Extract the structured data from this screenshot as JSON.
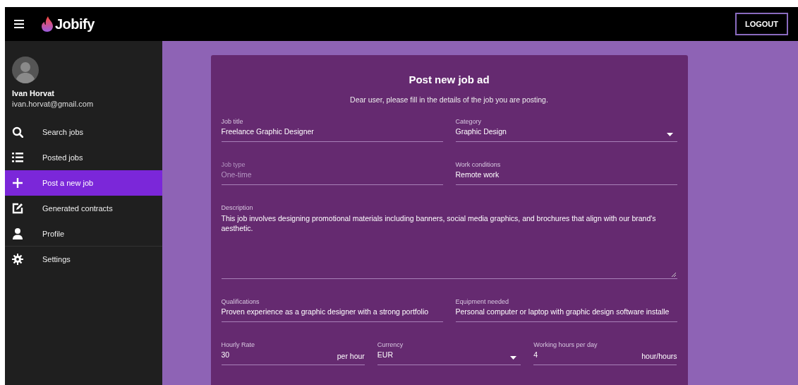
{
  "app_bar": {
    "brand": "Jobify",
    "logout": "LOGOUT"
  },
  "user": {
    "name": "Ivan Horvat",
    "email": "ivan.horvat@gmail.com"
  },
  "sidebar": {
    "items": [
      {
        "label": "Search jobs",
        "selected": false,
        "divider_after": false
      },
      {
        "label": "Posted jobs",
        "selected": false,
        "divider_after": false
      },
      {
        "label": "Post a new job",
        "selected": true,
        "divider_after": false
      },
      {
        "label": "Generated contracts",
        "selected": false,
        "divider_after": false
      },
      {
        "label": "Profile",
        "selected": false,
        "divider_after": true
      },
      {
        "label": "Settings",
        "selected": false,
        "divider_after": false
      }
    ]
  },
  "form": {
    "title": "Post new job ad",
    "subtitle": "Dear user, please fill in the details of the job you are posting.",
    "rows": [
      [
        {
          "kind": "text",
          "label": "Job title",
          "value": "Freelance Graphic Designer",
          "disabled": false
        },
        {
          "kind": "select",
          "label": "Category",
          "value": "Graphic Design",
          "disabled": false
        }
      ],
      [
        {
          "kind": "text",
          "label": "Job type",
          "value": "One-time",
          "disabled": true
        },
        {
          "kind": "text",
          "label": "Work conditions",
          "value": "Remote work",
          "disabled": false
        }
      ],
      [
        {
          "kind": "textarea",
          "label": "Description",
          "value": "This job involves designing promotional materials including banners, social media graphics, and brochures that align with our brand's aesthetic.",
          "disabled": false
        }
      ],
      [
        {
          "kind": "text",
          "label": "Qualifications",
          "value": "Proven experience as a graphic designer with a strong portfolio",
          "disabled": false
        },
        {
          "kind": "text",
          "label": "Equipment needed",
          "value": "Personal computer or laptop with graphic design software installe",
          "disabled": false
        }
      ],
      [
        {
          "kind": "suffix",
          "label": "Hourly Rate",
          "value": "30",
          "suffix": "per hour",
          "disabled": false
        },
        {
          "kind": "select",
          "label": "Currency",
          "value": "EUR",
          "disabled": false
        },
        {
          "kind": "suffix",
          "label": "Working hours per day",
          "value": "4",
          "suffix": "hour/hours",
          "disabled": false
        }
      ]
    ]
  }
}
